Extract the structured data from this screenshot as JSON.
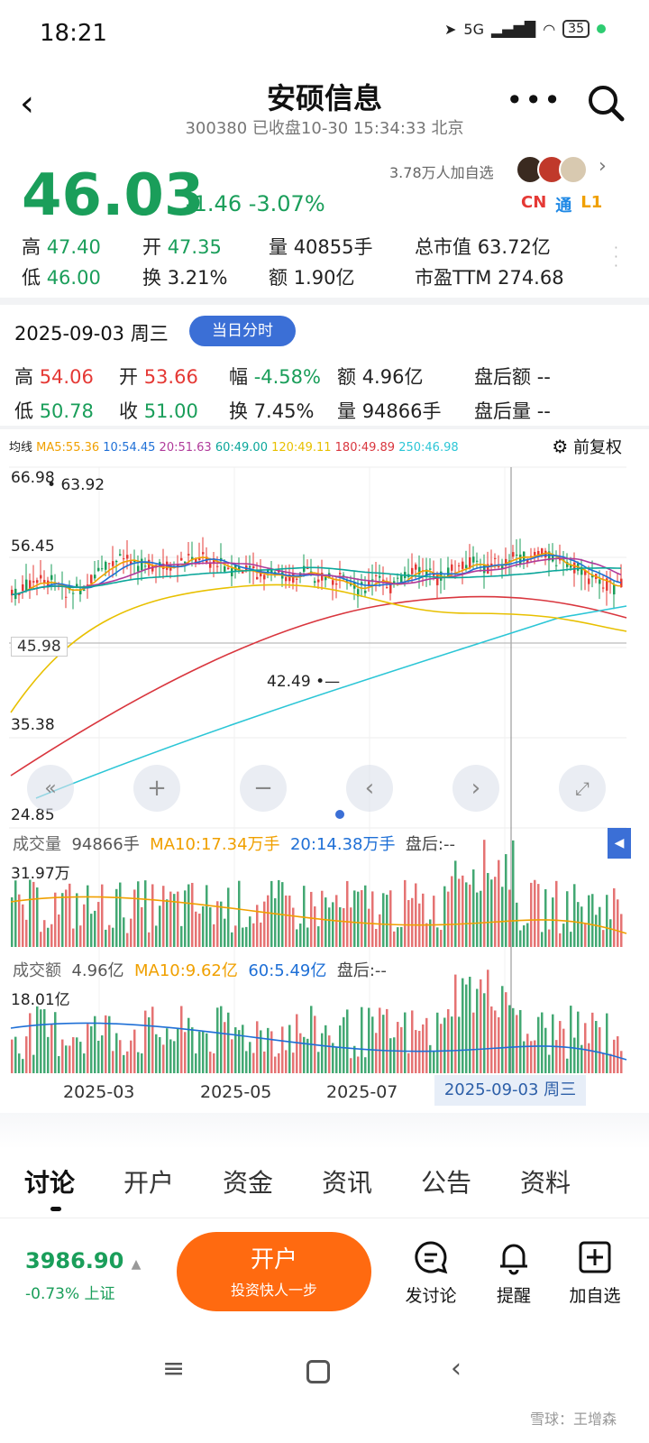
{
  "status": {
    "time": "18:21",
    "net": "5G",
    "battery": "35"
  },
  "header": {
    "title": "安硕信息",
    "subtitle": "300380 已收盘10-30 15:34:33 北京"
  },
  "quote": {
    "price": "46.03",
    "change": "-1.46 -3.07%",
    "watchers": "3.78万人加自选",
    "tags": [
      "CN",
      "通",
      "L1"
    ],
    "row1": [
      {
        "k": "高",
        "v": "47.40"
      },
      {
        "k": "开",
        "v": "47.35"
      },
      {
        "k": "量",
        "v": "40855手"
      },
      {
        "k": "总市值",
        "v": "63.72亿"
      }
    ],
    "row2": [
      {
        "k": "低",
        "v": "46.00"
      },
      {
        "k": "换",
        "v": "3.21%"
      },
      {
        "k": "额",
        "v": "1.90亿"
      },
      {
        "k": "市盈TTM",
        "v": "274.68"
      }
    ]
  },
  "day": {
    "date": "2025-09-03 周三",
    "pill": "当日分时",
    "row1": [
      {
        "k": "高",
        "v": "54.06"
      },
      {
        "k": "开",
        "v": "53.66"
      },
      {
        "k": "幅",
        "v": "-4.58%"
      },
      {
        "k": "额",
        "v": "4.96亿"
      },
      {
        "k": "盘后额",
        "v": "--"
      }
    ],
    "row2": [
      {
        "k": "低",
        "v": "50.78"
      },
      {
        "k": "收",
        "v": "51.00"
      },
      {
        "k": "换",
        "v": "7.45%"
      },
      {
        "k": "量",
        "v": "94866手"
      },
      {
        "k": "盘后量",
        "v": "--"
      }
    ]
  },
  "ma": {
    "label": "均线",
    "items": [
      {
        "t": "MA5:55.36",
        "c": "#f0a000"
      },
      {
        "t": "10:54.45",
        "c": "#1e6fd6"
      },
      {
        "t": "20:51.63",
        "c": "#b03a9a"
      },
      {
        "t": "60:49.00",
        "c": "#0aa69a"
      },
      {
        "t": "120:49.11",
        "c": "#e8c000"
      },
      {
        "t": "180:49.89",
        "c": "#d9363e"
      },
      {
        "t": "250:46.98",
        "c": "#2cc6d6"
      }
    ],
    "adjust": "前复权"
  },
  "chart_data": {
    "type": "candlestick",
    "y_ticks": [
      "66.98",
      "56.45",
      "45.98",
      "35.38",
      "24.85"
    ],
    "y_range": [
      24.85,
      66.98
    ],
    "annotations": {
      "high": "63.92",
      "low": "42.49",
      "current": "45.98"
    },
    "x_labels": [
      "2025-03",
      "2025-05",
      "2025-07"
    ],
    "selected": "2025-09-03 周三"
  },
  "volume": {
    "label": "成交量",
    "value": "94866手",
    "ma10": "MA10:17.34万手",
    "ma20": "20:14.38万手",
    "after": "盘后:--",
    "max": "31.97万"
  },
  "amount": {
    "label": "成交额",
    "value": "4.96亿",
    "ma10": "MA10:9.62亿",
    "ma60": "60:5.49亿",
    "after": "盘后:--",
    "max": "18.01亿"
  },
  "tabs": [
    "讨论",
    "开户",
    "资金",
    "资讯",
    "公告",
    "资料"
  ],
  "bottom": {
    "index_price": "3986.90",
    "index_change": "-0.73% 上证",
    "open_title": "开户",
    "open_sub": "投资快人一步",
    "actions": [
      "发讨论",
      "提醒",
      "加自选"
    ]
  },
  "watermark": "雪球：王增森"
}
